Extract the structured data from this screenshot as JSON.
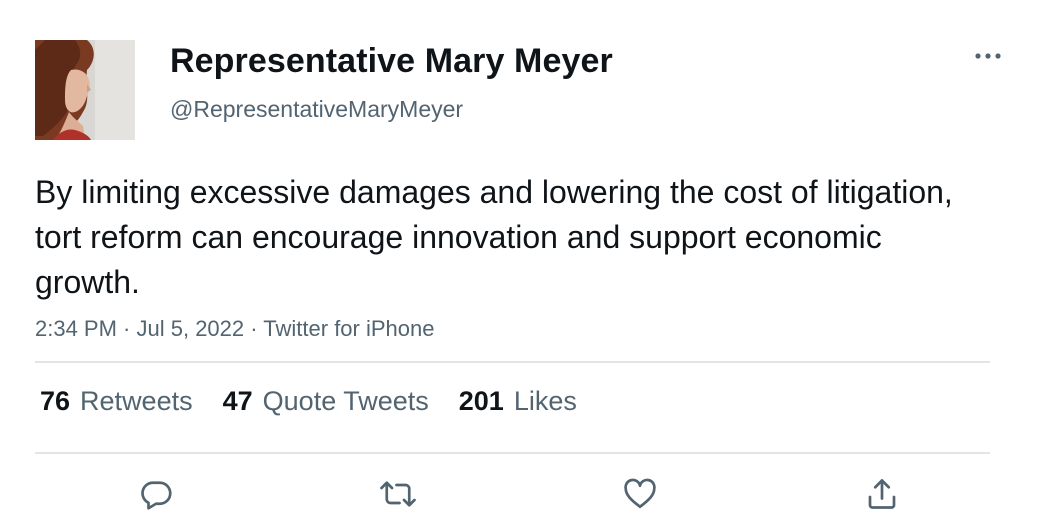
{
  "author": {
    "display_name": "Representative Mary Meyer",
    "handle": "@RepresentativeMaryMeyer",
    "avatar_icon": "profile-photo"
  },
  "tweet": {
    "text": "By limiting excessive damages and lowering the cost of litigation, tort reform can encourage innovation and support economic growth.",
    "time": "2:34 PM",
    "date": "Jul 5, 2022",
    "source": "Twitter for iPhone",
    "separator": " · "
  },
  "stats": {
    "retweets_count": "76",
    "retweets_label": "Retweets",
    "quotes_count": "47",
    "quotes_label": "Quote Tweets",
    "likes_count": "201",
    "likes_label": "Likes"
  },
  "actions": {
    "reply_icon": "reply-icon",
    "retweet_icon": "retweet-icon",
    "like_icon": "heart-icon",
    "share_icon": "share-icon",
    "more_icon": "more-icon"
  },
  "colors": {
    "text_primary": "#0f1419",
    "text_secondary": "#536471",
    "divider": "#e1e5e8"
  }
}
